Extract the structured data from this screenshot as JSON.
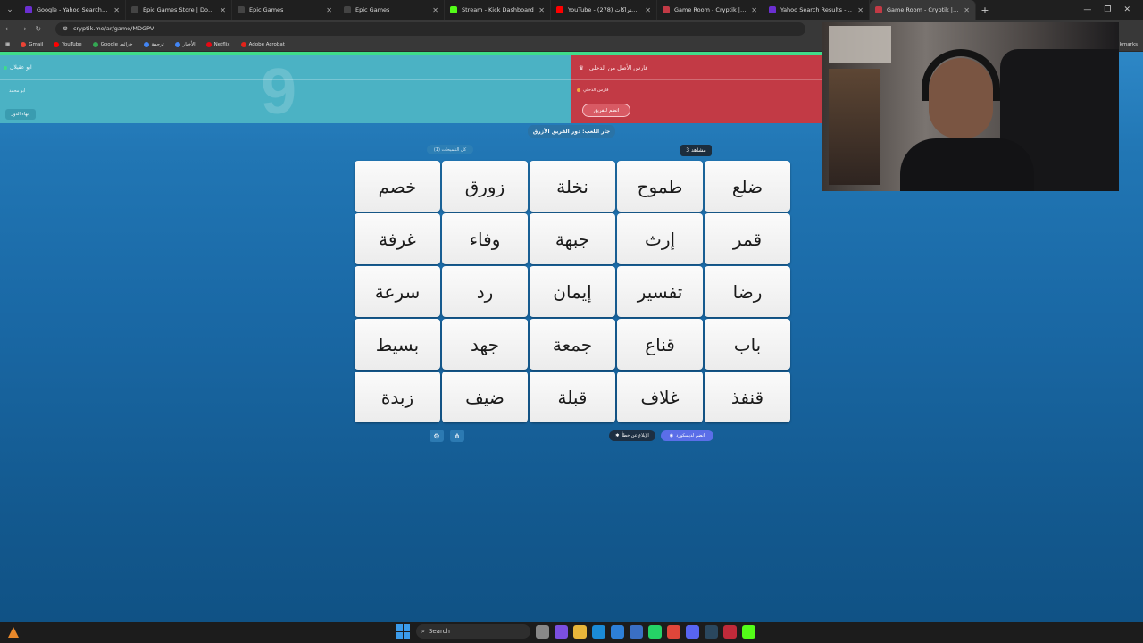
{
  "browser": {
    "tabs": [
      {
        "title": "Google - Yahoo Search Results",
        "favicon_color": "#6b2fd1",
        "active": false
      },
      {
        "title": "Epic Games Store | Download & ",
        "favicon_color": "#444444",
        "active": false
      },
      {
        "title": "Epic Games",
        "favicon_color": "#444444",
        "active": false
      },
      {
        "title": "Epic Games",
        "favicon_color": "#444444",
        "active": false
      },
      {
        "title": "Stream - Kick Dashboard",
        "favicon_color": "#53fc18",
        "active": false
      },
      {
        "title": "YouTube - الاشتراكات (278)",
        "favicon_color": "#ff0000",
        "active": false
      },
      {
        "title": "Game Room - Cryptik | Online ",
        "favicon_color": "#c23a45",
        "active": false
      },
      {
        "title": "Yahoo Search Results - كود نيمز",
        "favicon_color": "#6b2fd1",
        "active": false
      },
      {
        "title": "Game Room - Cryptik | Online ",
        "favicon_color": "#c23a45",
        "active": true
      }
    ],
    "url": "cryptik.me/ar/game/MDGPV",
    "bookmarks": [
      {
        "label": "Gmail",
        "color": "#ea4335"
      },
      {
        "label": "YouTube",
        "color": "#ff0000"
      },
      {
        "label": "Google خرائط",
        "color": "#34a853"
      },
      {
        "label": "ترجمة",
        "color": "#4285f4"
      },
      {
        "label": "الأخبار",
        "color": "#4285f4"
      },
      {
        "label": "Netflix",
        "color": "#e50914"
      },
      {
        "label": "Adobe Acrobat",
        "color": "#e2231a"
      }
    ],
    "bookmarks_more": "kmarks"
  },
  "game": {
    "blue_team": {
      "title": "ابو عقيلال",
      "member": "ابو محمد",
      "end_turn_label": "إنهاء الدور",
      "score": "9",
      "color": "#4bb2c4"
    },
    "red_team": {
      "title": "فارس الأصل من الدحلي",
      "member": "فارس الدحلي",
      "join_label": "انضم للفريق",
      "color": "#c23a45"
    },
    "turn_label": "جار اللعب: دور الفريق الأزرق",
    "hints_label": "كل التلميحات (1)",
    "viewers_label": "مشاهد 3",
    "cards": [
      [
        "ضلع",
        "طموح",
        "نخلة",
        "زورق",
        "خصم"
      ],
      [
        "قمر",
        "إرث",
        "جبهة",
        "وفاء",
        "غرفة"
      ],
      [
        "رضا",
        "تفسير",
        "إيمان",
        "رد",
        "سرعة"
      ],
      [
        "باب",
        "قناع",
        "جمعة",
        "جهد",
        "بسيط"
      ],
      [
        "قنفذ",
        "غلاف",
        "قبلة",
        "ضيف",
        "زبدة"
      ]
    ],
    "report_label": "الإبلاغ عن خطأ",
    "discord_label": "انضم لديسكورد"
  },
  "taskbar": {
    "search_placeholder": "Search"
  }
}
